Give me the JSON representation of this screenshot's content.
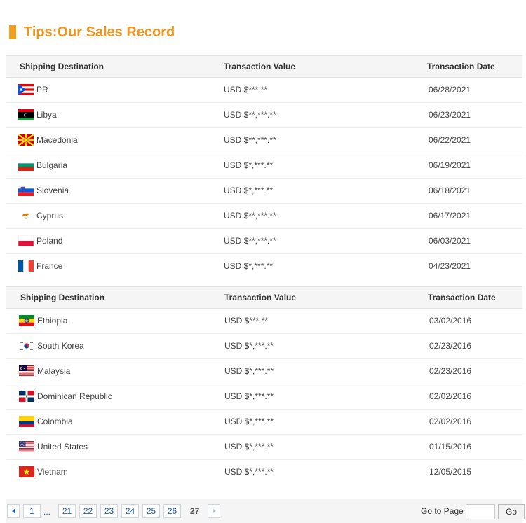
{
  "title": "Tips:Our Sales Record",
  "headers": {
    "destination": "Shipping Destination",
    "value": "Transaction Value",
    "date": "Transaction Date"
  },
  "table1": [
    {
      "country": "PR",
      "flag": "puerto-rico-flag",
      "value": "USD $***.**",
      "date": "06/28/2021"
    },
    {
      "country": "Libya",
      "flag": "libya-flag",
      "value": "USD $**,***.**",
      "date": "06/23/2021"
    },
    {
      "country": "Macedonia",
      "flag": "macedonia-flag",
      "value": "USD $**,***.**",
      "date": "06/22/2021"
    },
    {
      "country": "Bulgaria",
      "flag": "bulgaria-flag",
      "value": "USD $*,***.**",
      "date": "06/19/2021"
    },
    {
      "country": "Slovenia",
      "flag": "slovenia-flag",
      "value": "USD $*,***.**",
      "date": "06/18/2021"
    },
    {
      "country": "Cyprus",
      "flag": "cyprus-flag",
      "value": "USD $**,***.**",
      "date": "06/17/2021"
    },
    {
      "country": "Poland",
      "flag": "poland-flag",
      "value": "USD $**,***.**",
      "date": "06/03/2021"
    },
    {
      "country": "France",
      "flag": "france-flag",
      "value": "USD $*,***.**",
      "date": "04/23/2021"
    }
  ],
  "table2": [
    {
      "country": "Ethiopia",
      "flag": "ethiopia-flag",
      "value": "USD $***.**",
      "date": "03/02/2016"
    },
    {
      "country": "South Korea",
      "flag": "south-korea-flag",
      "value": "USD $*,***.**",
      "date": "02/23/2016"
    },
    {
      "country": "Malaysia",
      "flag": "malaysia-flag",
      "value": "USD $*,***.**",
      "date": "02/23/2016"
    },
    {
      "country": "Dominican Republic",
      "flag": "dominican-republic-flag",
      "value": "USD $*,***.**",
      "date": "02/02/2016"
    },
    {
      "country": "Colombia",
      "flag": "colombia-flag",
      "value": "USD $*,***.**",
      "date": "02/02/2016"
    },
    {
      "country": "United States",
      "flag": "united-states-flag",
      "value": "USD $*,***.**",
      "date": "01/15/2016"
    },
    {
      "country": "Vietnam",
      "flag": "vietnam-flag",
      "value": "USD $*,***.**",
      "date": "12/05/2015"
    }
  ],
  "pagination": {
    "first": "1",
    "ellipsis": "...",
    "pages": [
      "21",
      "22",
      "23",
      "24",
      "25",
      "26"
    ],
    "current": "27",
    "goto_label": "Go to Page",
    "goto_value": "",
    "go_label": "Go"
  },
  "colors": {
    "accent": "#f0951e",
    "link": "#1f5fa8",
    "header_bg": "#f5f5f5"
  }
}
